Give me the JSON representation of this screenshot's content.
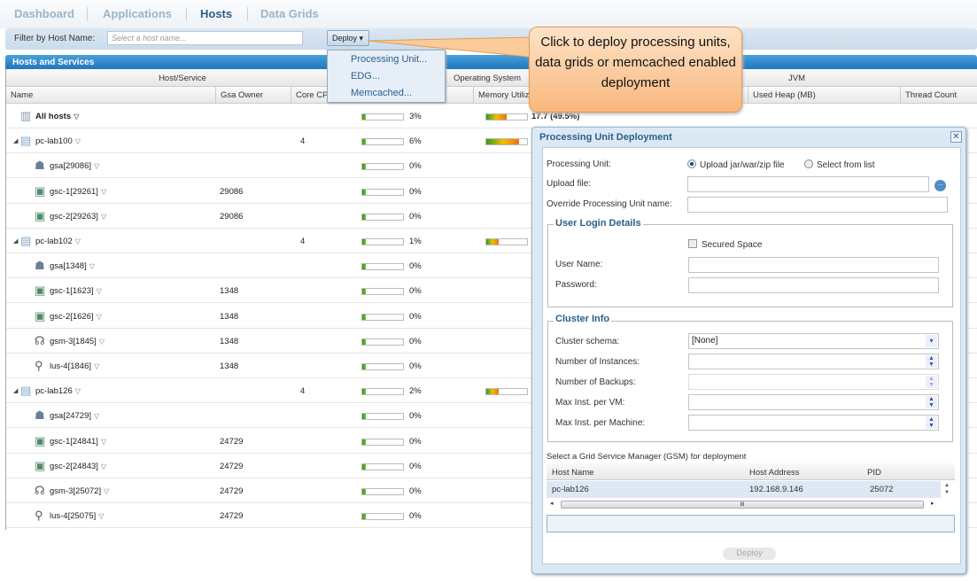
{
  "tabs": [
    "Dashboard",
    "Applications",
    "Hosts",
    "Data Grids"
  ],
  "active_tab": "Hosts",
  "filter": {
    "label": "Filter by Host Name:",
    "placeholder": "Select a host name...",
    "deploy_label": "Deploy ▾"
  },
  "deploy_menu": [
    "Processing Unit...",
    "EDG...",
    "Memcached..."
  ],
  "panel_title": "Hosts and Services",
  "group_headers": [
    "Host/Service",
    "Operating System",
    "JVM"
  ],
  "columns": [
    "Name",
    "Gsa Owner",
    "Core CPU",
    "Memory Utiliz",
    "Used Heap (MB)",
    "Thread Count"
  ],
  "rows": [
    {
      "name": "All hosts",
      "type": "all",
      "owner": "",
      "cores": "",
      "cpu": "3%",
      "cpu_frac": 0.03,
      "mem_frac": 0.495,
      "mem": "17.7 (49.5%)"
    },
    {
      "name": "pc-lab100",
      "type": "host",
      "owner": "",
      "cores": "4",
      "cpu": "6%",
      "cpu_frac": 0.06,
      "mem_frac": 0.8,
      "mem": ""
    },
    {
      "name": "gsa[29086]",
      "type": "gsa",
      "owner": "",
      "cores": "",
      "cpu": "0%",
      "cpu_frac": 0,
      "mem": ""
    },
    {
      "name": "gsc-1[29261]",
      "type": "gsc",
      "owner": "29086",
      "cores": "",
      "cpu": "0%",
      "cpu_frac": 0,
      "mem": ""
    },
    {
      "name": "gsc-2[29263]",
      "type": "gsc",
      "owner": "29086",
      "cores": "",
      "cpu": "0%",
      "cpu_frac": 0,
      "mem": ""
    },
    {
      "name": "pc-lab102",
      "type": "host",
      "owner": "",
      "cores": "4",
      "cpu": "1%",
      "cpu_frac": 0.01,
      "mem_frac": 0.3,
      "mem": ""
    },
    {
      "name": "gsa[1348]",
      "type": "gsa",
      "owner": "",
      "cores": "",
      "cpu": "0%",
      "cpu_frac": 0,
      "mem": ""
    },
    {
      "name": "gsc-1[1623]",
      "type": "gsc",
      "owner": "1348",
      "cores": "",
      "cpu": "0%",
      "cpu_frac": 0,
      "mem": ""
    },
    {
      "name": "gsc-2[1626]",
      "type": "gsc",
      "owner": "1348",
      "cores": "",
      "cpu": "0%",
      "cpu_frac": 0,
      "mem": ""
    },
    {
      "name": "gsm-3[1845]",
      "type": "gsm",
      "owner": "1348",
      "cores": "",
      "cpu": "0%",
      "cpu_frac": 0,
      "mem": ""
    },
    {
      "name": "lus-4[1846]",
      "type": "lus",
      "owner": "1348",
      "cores": "",
      "cpu": "0%",
      "cpu_frac": 0,
      "mem": ""
    },
    {
      "name": "pc-lab126",
      "type": "host",
      "owner": "",
      "cores": "4",
      "cpu": "2%",
      "cpu_frac": 0.02,
      "mem_frac": 0.3,
      "mem": ""
    },
    {
      "name": "gsa[24729]",
      "type": "gsa",
      "owner": "",
      "cores": "",
      "cpu": "0%",
      "cpu_frac": 0,
      "mem": ""
    },
    {
      "name": "gsc-1[24841]",
      "type": "gsc",
      "owner": "24729",
      "cores": "",
      "cpu": "0%",
      "cpu_frac": 0,
      "mem": ""
    },
    {
      "name": "gsc-2[24843]",
      "type": "gsc",
      "owner": "24729",
      "cores": "",
      "cpu": "0%",
      "cpu_frac": 0,
      "mem": ""
    },
    {
      "name": "gsm-3[25072]",
      "type": "gsm",
      "owner": "24729",
      "cores": "",
      "cpu": "0%",
      "cpu_frac": 0,
      "mem": ""
    },
    {
      "name": "lus-4[25075]",
      "type": "lus",
      "owner": "24729",
      "cores": "",
      "cpu": "0%",
      "cpu_frac": 0,
      "mem": ""
    }
  ],
  "callout": "Click to deploy processing units, data grids or memcached enabled deployment",
  "dialog": {
    "title": "Processing Unit Deployment",
    "pu_label": "Processing Unit:",
    "opt_upload": "Upload jar/war/zip file",
    "opt_list": "Select from list",
    "upload_label": "Upload file:",
    "override_label": "Override Processing Unit name:",
    "login_legend": "User Login Details",
    "secured": "Secured Space",
    "user_label": "User Name:",
    "pass_label": "Password:",
    "cluster_legend": "Cluster Info",
    "schema_label": "Cluster schema:",
    "schema_value": "[None]",
    "instances_label": "Number of Instances:",
    "backups_label": "Number of Backups:",
    "vm_label": "Max Inst. per VM:",
    "machine_label": "Max Inst. per Machine:",
    "gsm_label": "Select a Grid Service Manager (GSM) for deployment",
    "gsm_columns": [
      "Host Name",
      "Host Address",
      "PID"
    ],
    "gsm_row": [
      "pc-lab126",
      "192.168.9.146",
      "25072"
    ],
    "scroll_grip": "III",
    "deploy_button": "Deploy"
  }
}
